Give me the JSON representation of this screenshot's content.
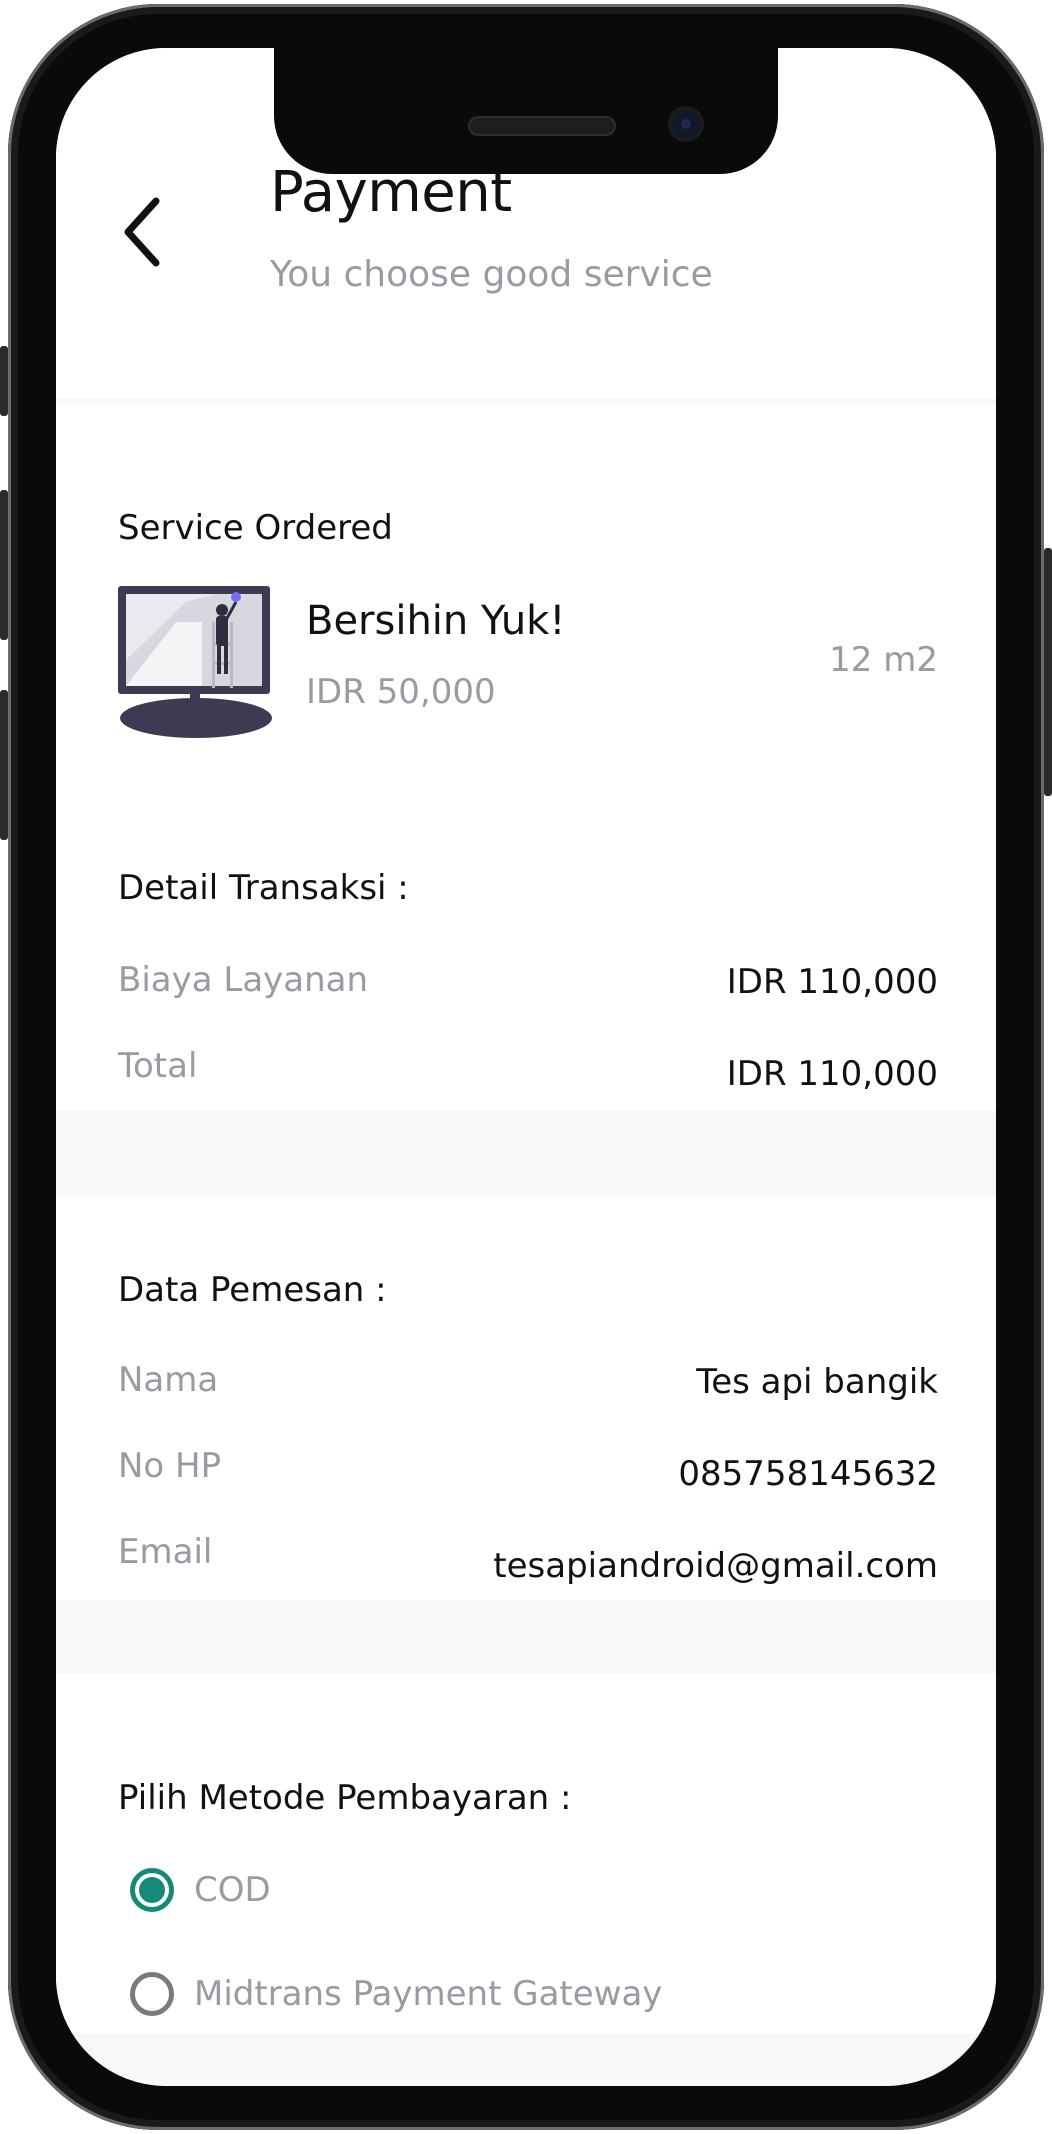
{
  "header": {
    "title": "Payment",
    "subtitle": "You choose good service"
  },
  "service": {
    "heading": "Service Ordered",
    "name": "Bersihin Yuk!",
    "price": "IDR 50,000",
    "quantity": "12 m2"
  },
  "transaction": {
    "heading": "Detail Transaksi :",
    "rows": [
      {
        "label": "Biaya Layanan",
        "value": "IDR 110,000"
      },
      {
        "label": "Total",
        "value": "IDR 110,000"
      }
    ]
  },
  "customer": {
    "heading": "Data Pemesan :",
    "rows": [
      {
        "label": "Nama",
        "value": "Tes api bangik"
      },
      {
        "label": "No HP",
        "value": "085758145632"
      },
      {
        "label": "Email",
        "value": "tesapiandroid@gmail.com"
      }
    ]
  },
  "payment": {
    "heading": "Pilih Metode Pembayaran :",
    "options": [
      {
        "label": "COD",
        "selected": true
      },
      {
        "label": "Midtrans Payment Gateway",
        "selected": false
      }
    ]
  },
  "colors": {
    "accent": "#168a78",
    "muted_text": "#9a9aa3",
    "primary_text": "#111111",
    "section_bg": "#f8f8f8"
  }
}
